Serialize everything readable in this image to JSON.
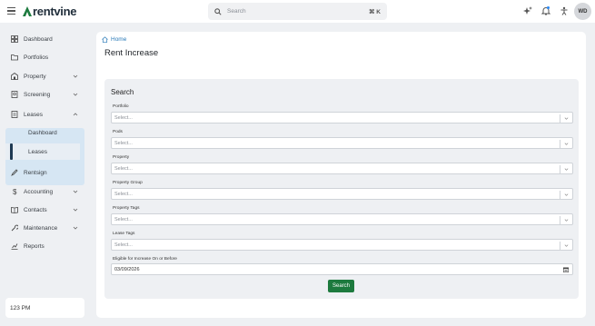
{
  "app": {
    "brand": "rentvine"
  },
  "topbar": {
    "search_placeholder": "Search",
    "search_shortcut": "⌘ K",
    "avatar_initials": "WD"
  },
  "sidebar": {
    "items": [
      {
        "label": "Dashboard",
        "icon": "dashboard-icon"
      },
      {
        "label": "Portfolios",
        "icon": "folder-icon"
      },
      {
        "label": "Property",
        "icon": "building-icon",
        "expandable": true
      },
      {
        "label": "Screening",
        "icon": "screening-icon",
        "expandable": true
      },
      {
        "label": "Leases",
        "icon": "lease-icon",
        "expandable": true,
        "expanded": true
      },
      {
        "label": "Rentsign",
        "icon": "pen-icon"
      },
      {
        "label": "Accounting",
        "icon": "dollar-icon",
        "expandable": true
      },
      {
        "label": "Contacts",
        "icon": "contact-book-icon",
        "expandable": true
      },
      {
        "label": "Maintenance",
        "icon": "wrench-icon",
        "expandable": true
      },
      {
        "label": "Reports",
        "icon": "chart-icon"
      }
    ],
    "lease_children": [
      {
        "label": "Dashboard"
      },
      {
        "label": "Leases",
        "selected": true
      }
    ],
    "clock": "123 PM"
  },
  "main": {
    "breadcrumb": "Home",
    "title": "Rent Increase",
    "panel_title": "Search",
    "fields": [
      {
        "label": "Portfolio",
        "value": "Select..."
      },
      {
        "label": "Pods",
        "value": "Select..."
      },
      {
        "label": "Property",
        "value": "Select..."
      },
      {
        "label": "Property Group",
        "value": "Select..."
      },
      {
        "label": "Property Tags",
        "value": "Select..."
      },
      {
        "label": "Lease Tags",
        "value": "Select..."
      }
    ],
    "date_field": {
      "label": "Eligible for Increase On or Before",
      "value": "03/09/2026"
    },
    "search_button": "Search"
  },
  "colors": {
    "accent_blue": "#2a7ab8",
    "search_green": "#1d7a3e",
    "active_nav_bg": "#d6e6f3",
    "notification_dot": "#2a8af6"
  }
}
